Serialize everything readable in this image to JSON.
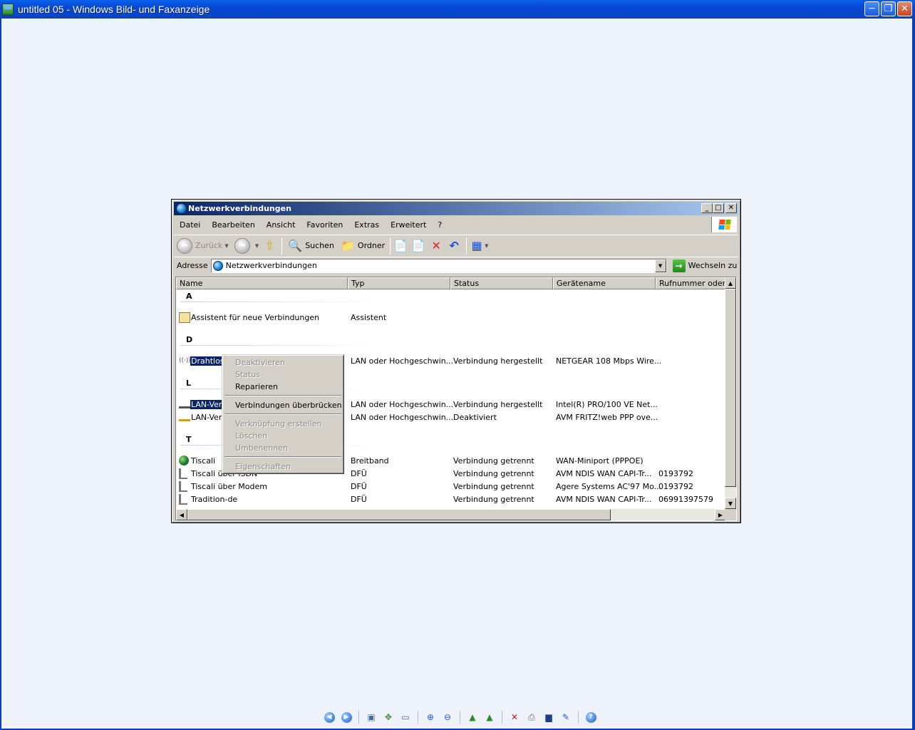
{
  "viewer": {
    "title": "untitled 05 - Windows Bild- und Faxanzeige",
    "buttons": {
      "minimize": "_",
      "maximize": "❐",
      "close": "✕"
    },
    "bottom_toolbar": [
      "prev-image-icon",
      "next-image-icon",
      "best-fit-icon",
      "actual-size-icon",
      "slideshow-icon",
      "zoom-in-icon",
      "zoom-out-icon",
      "rotate-cw-icon",
      "rotate-ccw-icon",
      "delete-icon",
      "print-icon",
      "save-icon",
      "edit-icon",
      "help-icon"
    ]
  },
  "window": {
    "title": "Netzwerkverbindungen",
    "menu": [
      "Datei",
      "Bearbeiten",
      "Ansicht",
      "Favoriten",
      "Extras",
      "Erweitert",
      "?"
    ],
    "toolbar": {
      "back": "Zurück",
      "search": "Suchen",
      "folders": "Ordner"
    },
    "address": {
      "label": "Adresse",
      "value": "Netzwerkverbindungen",
      "go": "Wechseln zu"
    },
    "columns": [
      "Name",
      "Typ",
      "Status",
      "Gerätename",
      "Rufnummer oder Ho"
    ],
    "groups": [
      {
        "letter": "A"
      },
      {
        "letter": "D"
      },
      {
        "letter": "L"
      },
      {
        "letter": "T"
      }
    ],
    "rows": [
      {
        "name": "Assistent für neue Verbindungen",
        "type": "Assistent",
        "status": "",
        "device": "",
        "number": "",
        "icon": "wizard-icon"
      },
      {
        "name": "Drahtlose",
        "type": "LAN oder Hochgeschwin...",
        "status": "Verbindung hergestellt",
        "device": "NETGEAR 108 Mbps Wire...",
        "number": "",
        "icon": "wireless-icon"
      },
      {
        "name": "LAN-Verb",
        "type": "LAN oder Hochgeschwin...",
        "status": "Verbindung hergestellt",
        "device": "Intel(R) PRO/100 VE Net...",
        "number": "",
        "icon": "lan-icon"
      },
      {
        "name": "LAN-Verb",
        "type": "LAN oder Hochgeschwin...",
        "status": "Deaktiviert",
        "device": "AVM FRITZ!web PPP ove...",
        "number": "",
        "icon": "lan-disabled-icon"
      },
      {
        "name": "Tiscali",
        "type": "Breitband",
        "status": "Verbindung getrennt",
        "device": "WAN-Miniport (PPPOE)",
        "number": "",
        "icon": "globe-icon"
      },
      {
        "name": "Tiscali über ISDN",
        "type": "DFÜ",
        "status": "Verbindung getrennt",
        "device": "AVM NDIS WAN CAPI-Tr...",
        "number": "0193792",
        "icon": "dialup-icon"
      },
      {
        "name": "Tiscali über Modem",
        "type": "DFÜ",
        "status": "Verbindung getrennt",
        "device": "Agere Systems AC'97 Mo...",
        "number": "0193792",
        "icon": "dialup-icon"
      },
      {
        "name": "Tradition-de",
        "type": "DFÜ",
        "status": "Verbindung getrennt",
        "device": "AVM NDIS WAN CAPI-Tr...",
        "number": "06991397579",
        "icon": "dialup-icon"
      }
    ]
  },
  "context_menu": [
    {
      "label": "Deaktivieren",
      "enabled": false
    },
    {
      "label": "Status",
      "enabled": false
    },
    {
      "label": "Reparieren",
      "enabled": true
    },
    {
      "label": "Verbindungen überbrücken",
      "enabled": true
    },
    {
      "label": "Verknüpfung erstellen",
      "enabled": false
    },
    {
      "label": "Löschen",
      "enabled": false
    },
    {
      "label": "Umbenennen",
      "enabled": false
    },
    {
      "label": "Eigenschaften",
      "enabled": false
    }
  ],
  "colors": {
    "xp_title": "#0547d6",
    "classic_title": "#0a246a",
    "selection": "#0a246a",
    "desktop": "#eef2fb"
  }
}
